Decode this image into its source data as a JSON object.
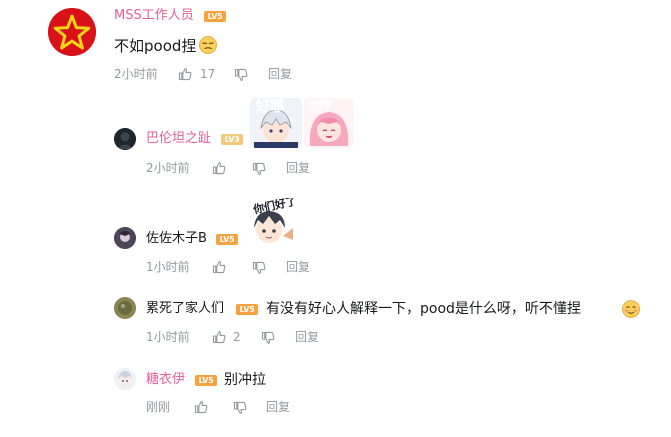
{
  "comments": [
    {
      "username": "MSS工作人员",
      "level": "LV5",
      "text": "不如pood捏",
      "time": "2小时前",
      "likes": "17",
      "reply_label": "回复"
    },
    {
      "username": "巴伦坦之趾",
      "level": "LV3",
      "stickers": [
        "好耶",
        "欢呼"
      ],
      "time": "2小时前",
      "reply_label": "回复"
    },
    {
      "username": "佐佐木子B",
      "level": "LV5",
      "stickers": [
        "你们好了"
      ],
      "time": "1小时前",
      "reply_label": "回复"
    },
    {
      "username": "累死了家人们",
      "level": "LV5",
      "text": "有没有好心人解释一下，pood是什么呀，听不懂捏",
      "time": "1小时前",
      "likes": "2",
      "reply_label": "回复"
    },
    {
      "username": "糖衣伊",
      "level": "LV5",
      "text": "别冲拉",
      "time": "刚刚",
      "reply_label": "回复"
    }
  ],
  "colors": {
    "vip_name": "#e45d95",
    "normal_name": "#61666d",
    "meta": "#9499a0",
    "level5": "#f8a23e",
    "level3": "#f2c87a"
  },
  "icons": [
    "star-avatar-icon",
    "like-icon",
    "dislike-icon",
    "smirk-emoji-icon",
    "blush-emoji-icon"
  ]
}
